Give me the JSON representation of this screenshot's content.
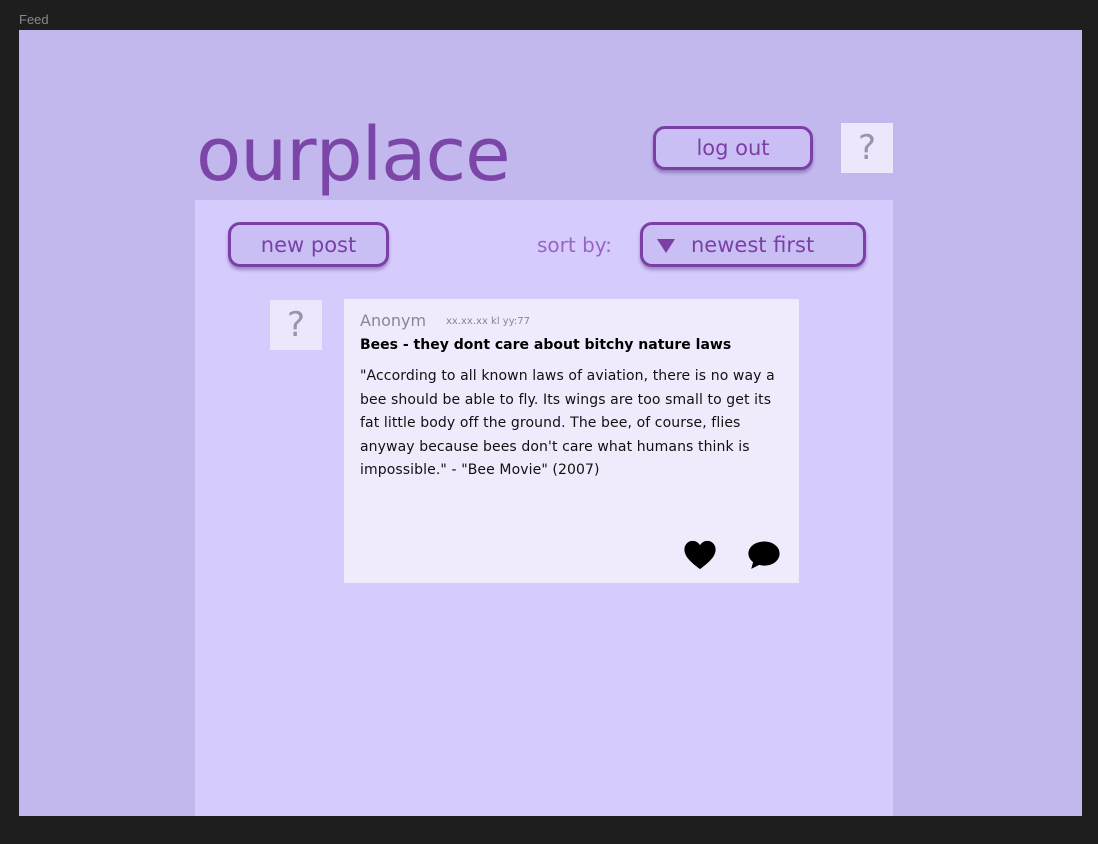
{
  "frame": {
    "label": "Feed"
  },
  "header": {
    "logo": "ourplace",
    "logout_label": "log out",
    "profile_placeholder": "?"
  },
  "toolbar": {
    "new_post_label": "new post",
    "sort_label": "sort by:",
    "sort_value": "newest first"
  },
  "posts": [
    {
      "avatar_placeholder": "?",
      "author": "Anonym",
      "handle": "xx.xx.xx kl yy:77",
      "title": "Bees - they dont care about bitchy nature laws",
      "body": "\"According to all known laws of aviation, there is no way a bee should be able to fly. Its wings are too small to get its fat little body off the ground. The bee, of course, flies anyway because bees don't care what humans think is impossible.\" - \"Bee Movie\" (2007)",
      "actions": [
        "heart-icon",
        "comment-icon"
      ]
    }
  ],
  "colors": {
    "background": "#c2b8ee",
    "panel": "#d5cbfd",
    "accent": "#7c3fa6",
    "card": "#efebfc"
  }
}
